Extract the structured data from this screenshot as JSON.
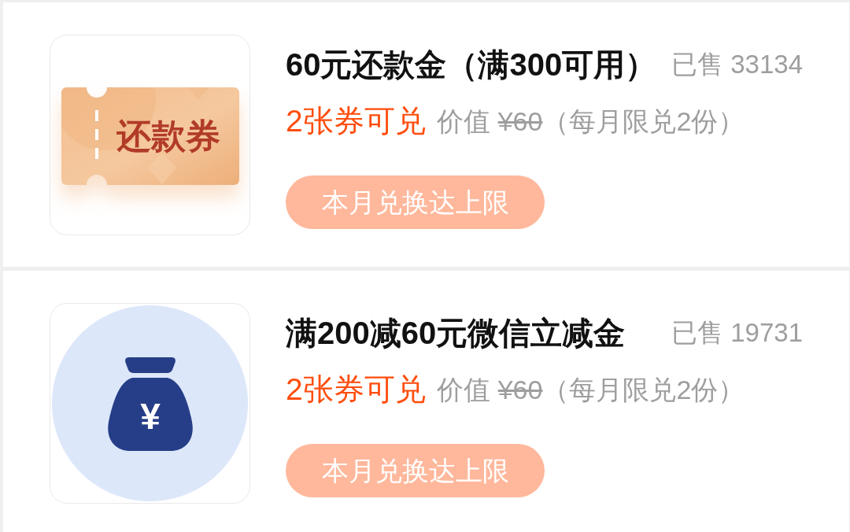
{
  "items": [
    {
      "image": {
        "kind": "ticket",
        "label": "还款券"
      },
      "title": "60元还款金（满300可用）",
      "sold": "已售 33134",
      "coupons": "2张券可兑",
      "value_label": "价值",
      "original_price": "¥60",
      "limit_note": "（每月限兑2份）",
      "button": {
        "label": "本月兑换达上限",
        "disabled": true
      }
    },
    {
      "image": {
        "kind": "money_bag",
        "symbol": "¥"
      },
      "title": "满200减60元微信立减金",
      "sold": "已售 19731",
      "coupons": "2张券可兑",
      "value_label": "价值",
      "original_price": "¥60",
      "limit_note": "（每月限兑2份）",
      "button": {
        "label": "本月兑换达上限",
        "disabled": true
      }
    }
  ]
}
